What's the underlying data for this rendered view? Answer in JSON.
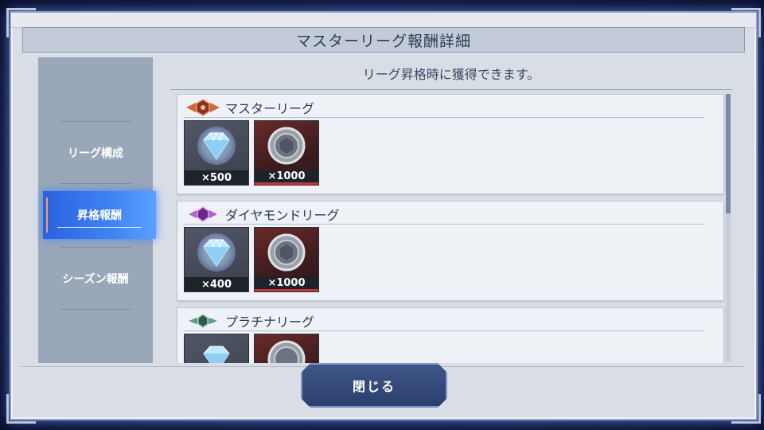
{
  "window": {
    "title": "マスターリーグ報酬詳細"
  },
  "sidebar": {
    "items": [
      {
        "label": "リーグ構成"
      },
      {
        "label": "昇格報酬"
      },
      {
        "label": "シーズン報酬"
      }
    ]
  },
  "main": {
    "notice": "リーグ昇格時に獲得できます。",
    "sections": [
      {
        "title": "マスターリーグ",
        "icon": "master-league-emblem-icon",
        "rewards": [
          {
            "icon": "diamond-gem-icon",
            "qty": "×500"
          },
          {
            "icon": "master-league-medal-icon",
            "qty": "×1000"
          }
        ]
      },
      {
        "title": "ダイヤモンドリーグ",
        "icon": "diamond-league-emblem-icon",
        "rewards": [
          {
            "icon": "diamond-gem-icon",
            "qty": "×400"
          },
          {
            "icon": "master-league-medal-icon",
            "qty": "×1000"
          }
        ]
      },
      {
        "title": "プラチナリーグ",
        "icon": "platinum-league-emblem-icon",
        "rewards": [
          {
            "icon": "diamond-gem-icon"
          },
          {
            "icon": "master-league-medal-icon"
          }
        ]
      }
    ]
  },
  "footer": {
    "close_label": "閉じる"
  },
  "colors": {
    "active_tab": "#3f83f2",
    "medal_accent": "#c8333a",
    "background": "#141c48"
  }
}
